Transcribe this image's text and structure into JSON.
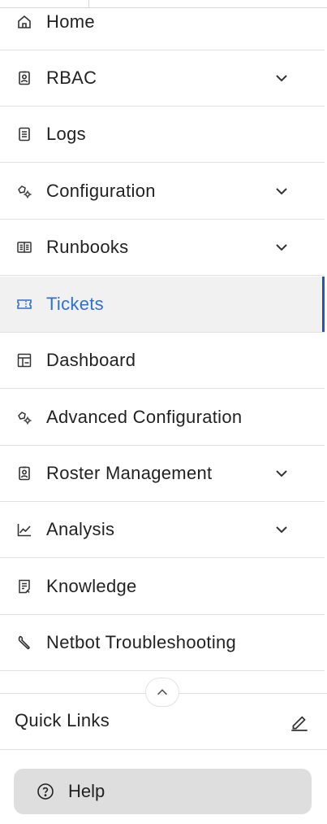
{
  "sidebar": {
    "items": [
      {
        "label": "Home",
        "icon": "home-icon",
        "has_chevron": false,
        "active": false
      },
      {
        "label": "RBAC",
        "icon": "id-badge-icon",
        "has_chevron": true,
        "active": false
      },
      {
        "label": "Logs",
        "icon": "list-doc-icon",
        "has_chevron": false,
        "active": false
      },
      {
        "label": "Configuration",
        "icon": "gear-config-icon",
        "has_chevron": true,
        "active": false
      },
      {
        "label": "Runbooks",
        "icon": "book-open-icon",
        "has_chevron": true,
        "active": false
      },
      {
        "label": "Tickets",
        "icon": "ticket-icon",
        "has_chevron": false,
        "active": true
      },
      {
        "label": "Dashboard",
        "icon": "dashboard-icon",
        "has_chevron": false,
        "active": false
      },
      {
        "label": "Advanced Configuration",
        "icon": "gear-config-icon",
        "has_chevron": false,
        "active": false
      },
      {
        "label": "Roster Management",
        "icon": "id-badge-icon",
        "has_chevron": true,
        "active": false
      },
      {
        "label": "Analysis",
        "icon": "chart-line-icon",
        "has_chevron": true,
        "active": false
      },
      {
        "label": "Knowledge",
        "icon": "knowledge-doc-icon",
        "has_chevron": false,
        "active": false
      },
      {
        "label": "Netbot Troubleshooting",
        "icon": "wrench-icon",
        "has_chevron": false,
        "active": false
      }
    ]
  },
  "quick_links": {
    "label": "Quick Links"
  },
  "help": {
    "label": "Help"
  },
  "colors": {
    "active_text": "#2f6fd6",
    "active_bar": "#1e57b8",
    "help_bg": "#dedede"
  }
}
